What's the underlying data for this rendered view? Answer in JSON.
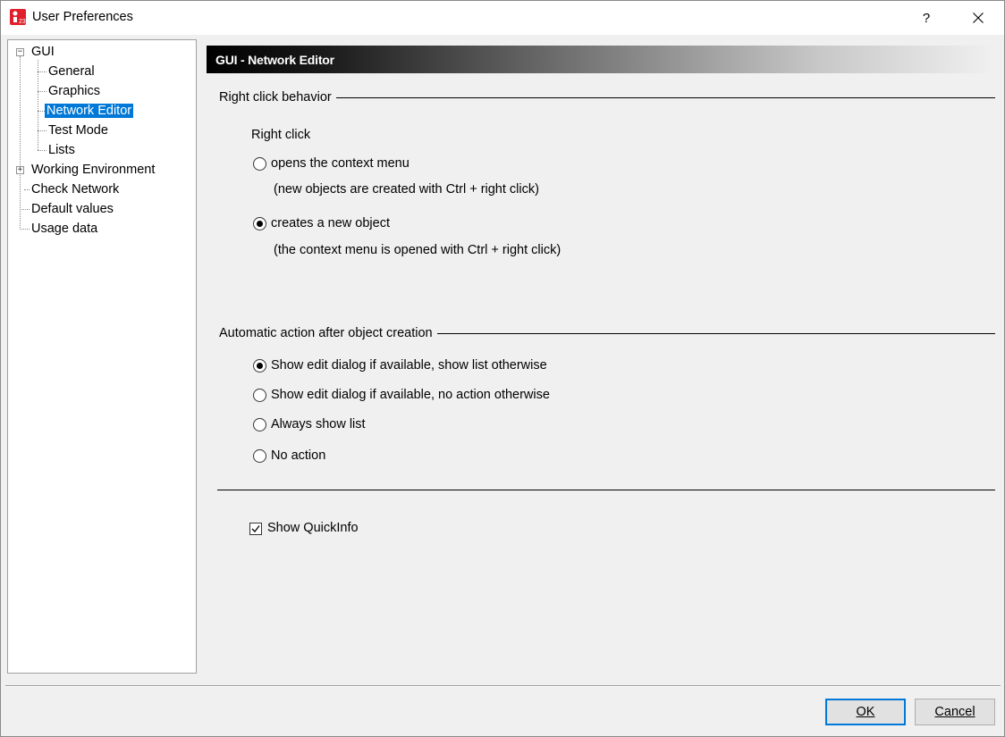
{
  "window": {
    "title": "User Preferences",
    "help_label": "?",
    "close_label": "✕"
  },
  "tree": {
    "root": "GUI",
    "root_expander": "−",
    "children": [
      "General",
      "Graphics",
      "Network Editor",
      "Test Mode",
      "Lists"
    ],
    "selected": "Network Editor",
    "working_env": "Working Environment",
    "working_env_expander": "+",
    "others": [
      "Check Network",
      "Default values",
      "Usage data"
    ]
  },
  "panel": {
    "header": "GUI - Network Editor",
    "right_click_group": {
      "title": "Right click behavior",
      "subtitle": "Right click",
      "options": [
        {
          "label": "opens the context menu",
          "hint": "(new objects are created with Ctrl + right click)",
          "checked": false
        },
        {
          "label": "creates a new object",
          "hint": "(the context menu is opened with Ctrl + right click)",
          "checked": true
        }
      ]
    },
    "auto_action_group": {
      "title": "Automatic action after object creation",
      "options": [
        {
          "label": "Show edit dialog if available, show list otherwise",
          "checked": true
        },
        {
          "label": "Show edit dialog if available, no action otherwise",
          "checked": false
        },
        {
          "label": "Always show list",
          "checked": false
        },
        {
          "label": "No action",
          "checked": false
        }
      ]
    },
    "quickinfo": {
      "label": "Show QuickInfo",
      "checked": true
    }
  },
  "buttons": {
    "ok": "OK",
    "cancel": "Cancel"
  },
  "colors": {
    "selection": "#0078d7",
    "app_icon": "#e0202a"
  }
}
